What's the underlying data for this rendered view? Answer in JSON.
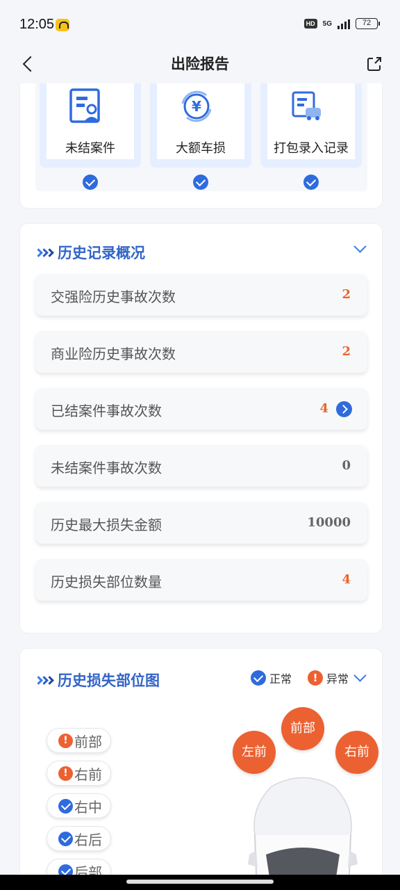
{
  "status_bar": {
    "time": "12:05",
    "hd": "HD",
    "network": "5G",
    "battery": "72"
  },
  "navbar": {
    "title": "出险报告"
  },
  "tiles": [
    {
      "label": "未结案件",
      "icon": "document-user-icon",
      "checked": true
    },
    {
      "label": "大额车损",
      "icon": "yen-refresh-icon",
      "checked": true
    },
    {
      "label": "打包录入记录",
      "icon": "car-record-icon",
      "checked": true
    }
  ],
  "history_summary": {
    "title": "历史记录概况",
    "rows": [
      {
        "label": "交强险历史事故次数",
        "value": "2"
      },
      {
        "label": "商业险历史事故次数",
        "value": "2"
      },
      {
        "label": "已结案件事故次数",
        "value": "4"
      },
      {
        "label": "未结案件事故次数",
        "value": "0"
      },
      {
        "label": "历史最大损失金额",
        "value": "10000"
      },
      {
        "label": "历史损失部位数量",
        "value": "4"
      }
    ]
  },
  "damage_map": {
    "title": "历史损失部位图",
    "legend_normal": "正常",
    "legend_abnormal": "异常",
    "abnormal_mark": "!",
    "parts": [
      {
        "label": "前部",
        "status": "abnormal"
      },
      {
        "label": "右前",
        "status": "abnormal"
      },
      {
        "label": "右中",
        "status": "normal"
      },
      {
        "label": "右后",
        "status": "normal"
      },
      {
        "label": "后部",
        "status": "normal"
      }
    ],
    "car_bubbles": {
      "front": "前部",
      "front_left": "左前",
      "front_right": "右前"
    }
  },
  "colors": {
    "accent_blue": "#2f6bde",
    "title_blue": "#3264c8",
    "abnormal_orange": "#ec6132",
    "value_orange": "#e8652c"
  }
}
